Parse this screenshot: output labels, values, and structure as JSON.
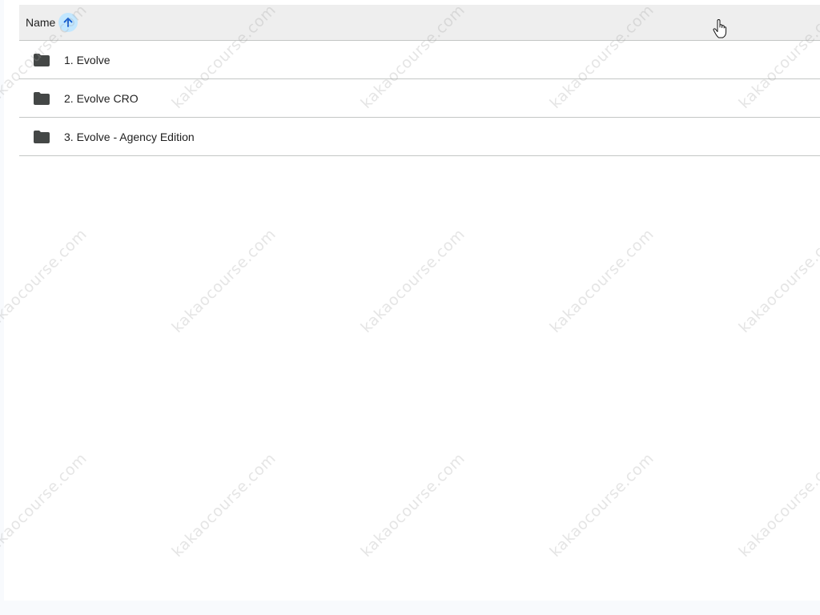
{
  "header": {
    "name_label": "Name",
    "sort_direction": "ascending",
    "sort_icon": "arrow-up-icon"
  },
  "folders": [
    {
      "name": "1. Evolve",
      "icon": "folder-icon"
    },
    {
      "name": "2. Evolve CRO",
      "icon": "folder-icon"
    },
    {
      "name": "3. Evolve - Agency Edition",
      "icon": "folder-icon"
    }
  ],
  "watermark": {
    "text": "kakaocourse.com"
  },
  "colors": {
    "header_bg": "#eeeeee",
    "sort_accent": "#c2e7ff",
    "divider": "#c4c7c5",
    "folder": "#444746",
    "text": "#1f1f1f"
  }
}
